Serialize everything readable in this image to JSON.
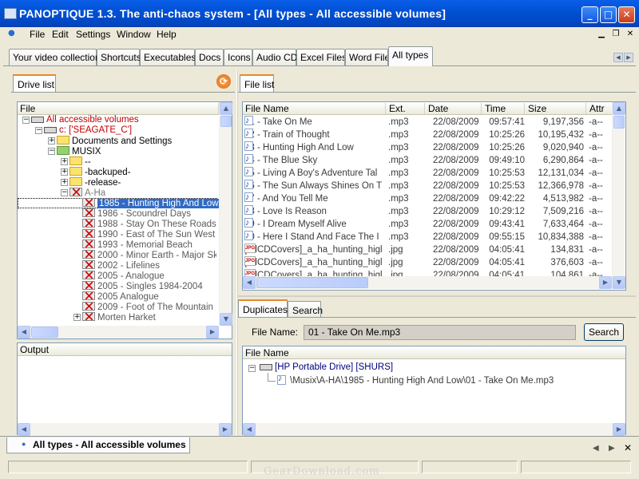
{
  "window": {
    "title": "PANOPTIQUE 1.3. The anti-chaos system - [All types - All accessible volumes]",
    "min_label": "_",
    "max_label": "□",
    "close_label": "✕"
  },
  "menu": {
    "items": [
      "File",
      "Edit",
      "Settings",
      "Window",
      "Help"
    ]
  },
  "tabs": [
    "Your video collection",
    "Shortcuts",
    "Executables",
    "Docs",
    "Icons",
    "Audio CD",
    "Excel Files",
    "Word Files",
    "All types"
  ],
  "active_tab": "All types",
  "drive_panel": {
    "tab_label": "Drive list",
    "header": "File",
    "tree": [
      {
        "label": "All accessible volumes",
        "color": "#c00000"
      },
      {
        "label": "c: ['SEAGATE_C']",
        "color": "#c00000"
      },
      {
        "label": "Documents and Settings",
        "color": "#000000"
      },
      {
        "label": "MUSIX",
        "color": "#000000"
      },
      {
        "label": "--",
        "color": "#000000"
      },
      {
        "label": "-backuped-",
        "color": "#000000"
      },
      {
        "label": "-release-",
        "color": "#000000"
      },
      {
        "label": "A-Ha",
        "color": "#7a7a7a"
      },
      {
        "label": "1985 - Hunting High And Low",
        "color": "#ffffff"
      },
      {
        "label": "1986 - Scoundrel Days",
        "color": "#5a5a5a"
      },
      {
        "label": "1988 - Stay On These Roads",
        "color": "#5a5a5a"
      },
      {
        "label": "1990 - East of The Sun West of",
        "color": "#5a5a5a"
      },
      {
        "label": "1993 - Memorial Beach",
        "color": "#5a5a5a"
      },
      {
        "label": "2000 - Minor Earth - Major Sky",
        "color": "#5a5a5a"
      },
      {
        "label": "2002 - Lifelines",
        "color": "#5a5a5a"
      },
      {
        "label": "2005 - Analogue",
        "color": "#5a5a5a"
      },
      {
        "label": "2005 - Singles 1984-2004",
        "color": "#5a5a5a"
      },
      {
        "label": "2005 Analogue",
        "color": "#5a5a5a"
      },
      {
        "label": "2009 - Foot of The Mountain",
        "color": "#5a5a5a"
      },
      {
        "label": "Morten Harket",
        "color": "#5a5a5a"
      }
    ]
  },
  "output_panel": {
    "header": "Output"
  },
  "file_list": {
    "tab_label": "File list",
    "columns": [
      "File Name",
      "Ext.",
      "Date",
      "Time",
      "Size",
      "Attr"
    ],
    "rows": [
      {
        "name": "01 - Take On Me",
        "ext": ".mp3",
        "date": "22/08/2009",
        "time": "09:57:41",
        "size": "9,197,356",
        "attr": "-a--",
        "type": "audio"
      },
      {
        "name": "02 - Train of  Thought",
        "ext": ".mp3",
        "date": "22/08/2009",
        "time": "10:25:26",
        "size": "10,195,432",
        "attr": "-a--",
        "type": "audio"
      },
      {
        "name": "03 - Hunting High And Low",
        "ext": ".mp3",
        "date": "22/08/2009",
        "time": "10:25:26",
        "size": "9,020,940",
        "attr": "-a--",
        "type": "audio"
      },
      {
        "name": "04 - The Blue Sky",
        "ext": ".mp3",
        "date": "22/08/2009",
        "time": "09:49:10",
        "size": "6,290,864",
        "attr": "-a--",
        "type": "audio"
      },
      {
        "name": "05 - Living A Boy's Adventure Tal",
        "ext": ".mp3",
        "date": "22/08/2009",
        "time": "10:25:53",
        "size": "12,131,034",
        "attr": "-a--",
        "type": "audio"
      },
      {
        "name": "06 - The Sun Always Shines On T",
        "ext": ".mp3",
        "date": "22/08/2009",
        "time": "10:25:53",
        "size": "12,366,978",
        "attr": "-a--",
        "type": "audio"
      },
      {
        "name": "07 - And You Tell Me",
        "ext": ".mp3",
        "date": "22/08/2009",
        "time": "09:42:22",
        "size": "4,513,982",
        "attr": "-a--",
        "type": "audio"
      },
      {
        "name": "08 - Love Is Reason",
        "ext": ".mp3",
        "date": "22/08/2009",
        "time": "10:29:12",
        "size": "7,509,216",
        "attr": "-a--",
        "type": "audio"
      },
      {
        "name": "09 - I Dream Myself Alive",
        "ext": ".mp3",
        "date": "22/08/2009",
        "time": "09:43:41",
        "size": "7,633,464",
        "attr": "-a--",
        "type": "audio"
      },
      {
        "name": "10 - Here I Stand And Face The I",
        "ext": ".mp3",
        "date": "22/08/2009",
        "time": "09:55:15",
        "size": "10,834,388",
        "attr": "-a--",
        "type": "audio"
      },
      {
        "name": "[AllCDCovers]_a_ha_hunting_higl",
        "ext": ".jpg",
        "date": "22/08/2009",
        "time": "04:05:41",
        "size": "134,831",
        "attr": "-a--",
        "type": "image"
      },
      {
        "name": "[AllCDCovers]_a_ha_hunting_higl",
        "ext": ".jpg",
        "date": "22/08/2009",
        "time": "04:05:41",
        "size": "376,603",
        "attr": "-a--",
        "type": "image"
      },
      {
        "name": "[AllCDCovers]_a_ha_hunting_higl",
        "ext": ".jpg",
        "date": "22/08/2009",
        "time": "04:05:41",
        "size": "104,861",
        "attr": "-a--",
        "type": "image"
      }
    ]
  },
  "duplicates": {
    "tab_label": "Duplicates",
    "search_tab_label": "Search",
    "file_name_label": "File Name:",
    "file_name_value": "01 - Take On Me.mp3",
    "search_button": "Search",
    "header": "File Name",
    "drive_entry": "[HP Portable Drive] [SHURS]",
    "path_entry": "\\Musix\\A-HA\\1985 - Hunting High And Low\\01 - Take On Me.mp3"
  },
  "bottom_tab": {
    "label": "All types - All accessible volumes"
  },
  "watermark": "GearDownload.com",
  "colors": {
    "titlebar": "#0051d4",
    "selection": "#316ac5",
    "tree_red": "#c00000",
    "drive_blue": "#000080"
  }
}
